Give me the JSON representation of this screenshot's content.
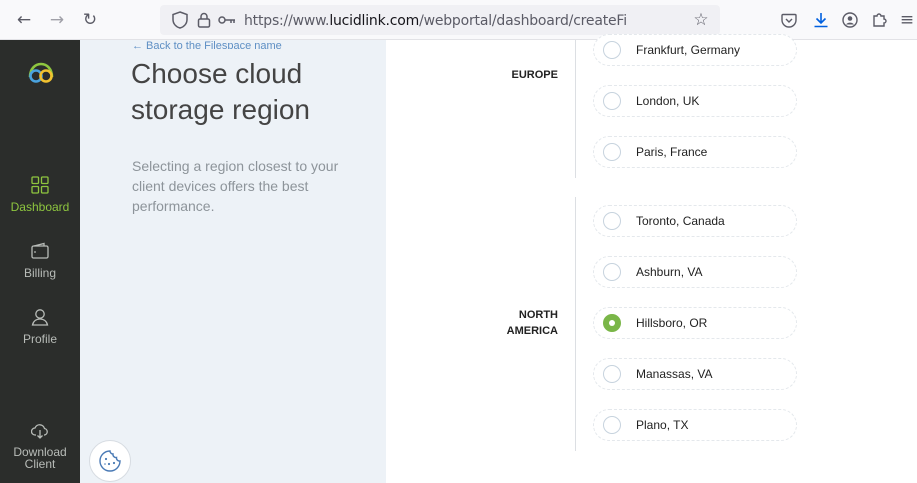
{
  "browser": {
    "url_prefix": "https://www.",
    "url_domain": "lucidlink.com",
    "url_path": "/webportal/dashboard/createFilespace/cloudstorage"
  },
  "sidebar": {
    "items": [
      {
        "label": "Dashboard",
        "icon": "grid-icon",
        "active": true
      },
      {
        "label": "Billing",
        "icon": "wallet-icon",
        "active": false
      },
      {
        "label": "Profile",
        "icon": "user-icon",
        "active": false
      },
      {
        "label": "Download Client",
        "icon": "cloud-download-icon",
        "active": false
      }
    ]
  },
  "panel": {
    "back_link": "← Back to the Filespace name",
    "title": "Choose cloud storage region",
    "description": "Selecting a region closest to your client devices offers the best performance."
  },
  "regions": [
    {
      "name": "EUROPE",
      "options": [
        "Frankfurt, Germany",
        "London, UK",
        "Paris, France"
      ]
    },
    {
      "name": "NORTH AMERICA",
      "options": [
        "Toronto, Canada",
        "Ashburn, VA",
        "Hillsboro, OR",
        "Manassas, VA",
        "Plano, TX"
      ]
    }
  ],
  "selected_option": "Hillsboro, OR",
  "colors": {
    "accent": "#7ab648",
    "sidebar_bg": "#2b2d2b",
    "panel_bg": "#edf2f7"
  }
}
